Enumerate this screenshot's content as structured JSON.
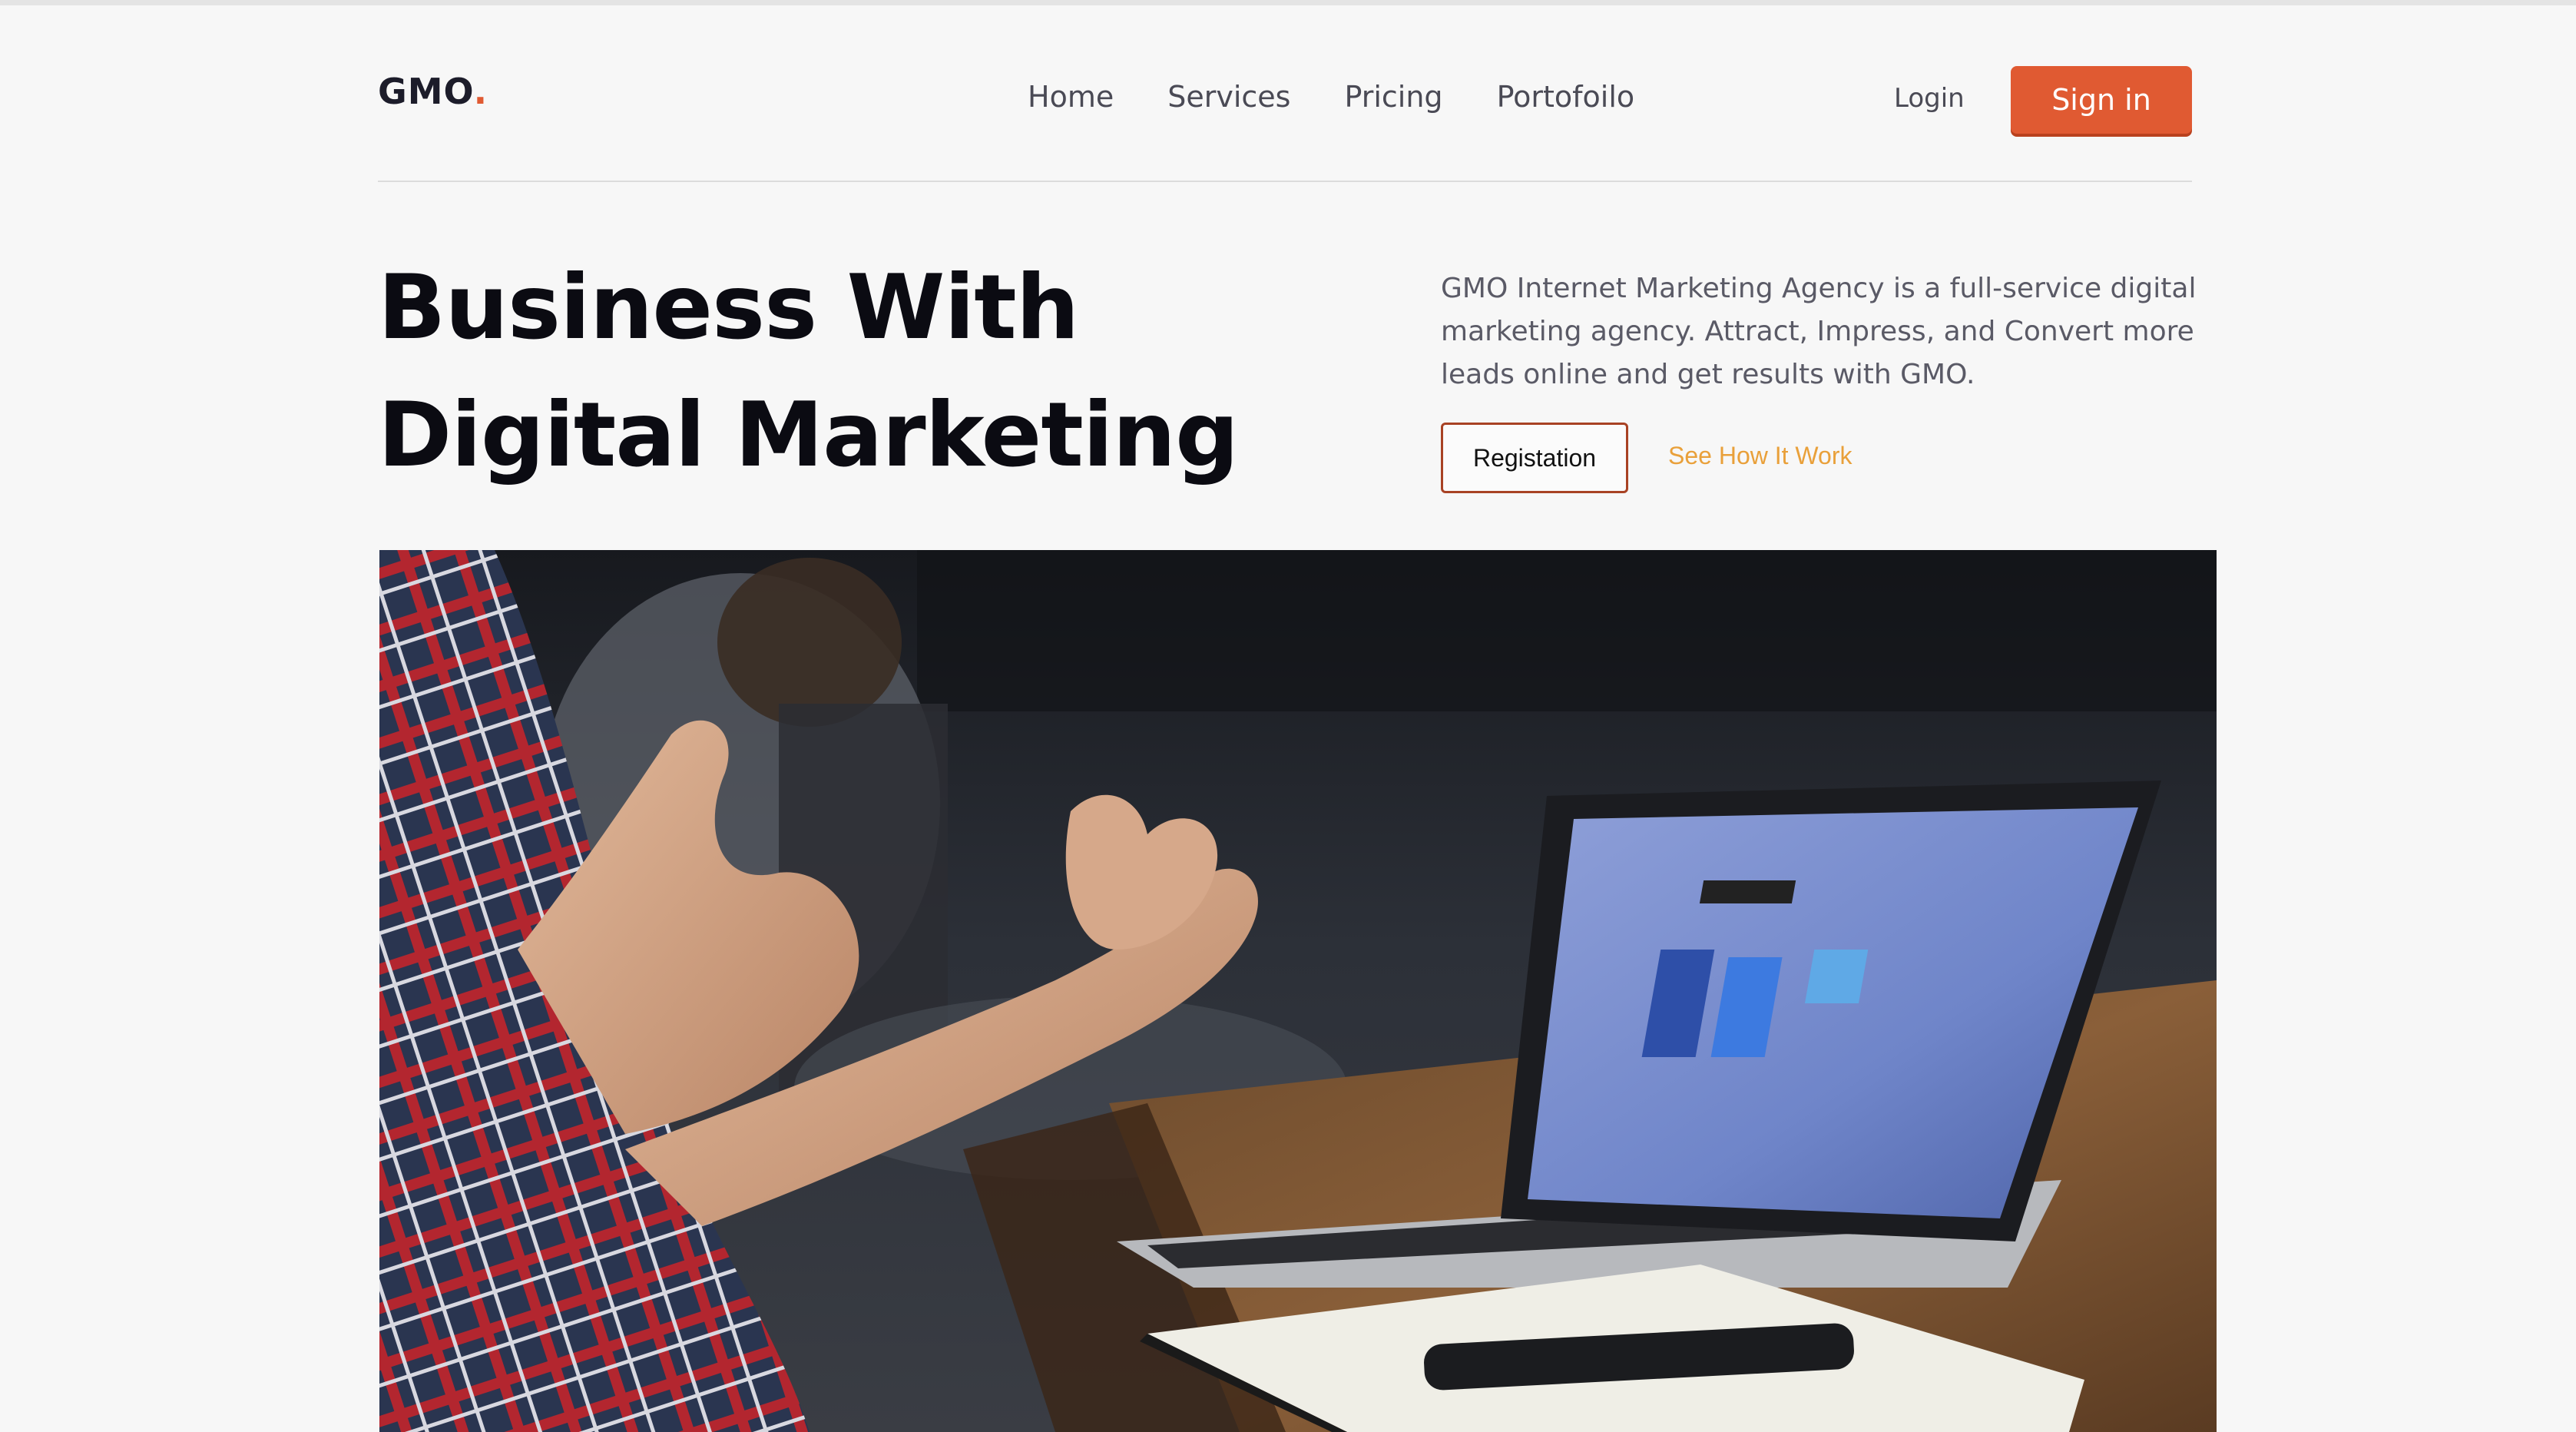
{
  "header": {
    "logo_text": "GMO",
    "logo_dot": ".",
    "nav_items": [
      {
        "label": "Home"
      },
      {
        "label": "Services"
      },
      {
        "label": "Pricing"
      },
      {
        "label": "Portofoilo"
      }
    ],
    "login_label": "Login",
    "signin_label": "Sign in"
  },
  "hero": {
    "title_line1": "Business With",
    "title_line2": "Digital Marketing",
    "description": "GMO Internet Marketing Agency is a full-service digital marketing agency. Attract, Impress, and Convert more leads online and get results with GMO.",
    "registration_label": "Registation",
    "see_how_label": "See How It Work"
  },
  "colors": {
    "accent": "#e05a32",
    "secondary_link": "#e9a03a",
    "background": "#f7f7f7"
  }
}
